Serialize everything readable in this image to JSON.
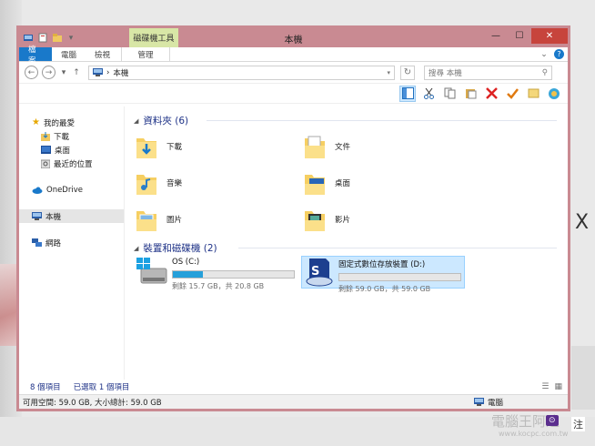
{
  "window": {
    "title": "本機",
    "context_tab": "磁碟機工具",
    "minimize": "—",
    "maximize": "☐",
    "close": "✕"
  },
  "ribbon": {
    "tabs": [
      "檔案",
      "電腦",
      "檢視",
      "管理"
    ],
    "help": "?"
  },
  "address": {
    "back": "←",
    "forward": "→",
    "up": "↑",
    "path_sep": "›",
    "path": "本機",
    "refresh": "↻",
    "search_placeholder": "搜尋 本機",
    "search_icon": "⚲"
  },
  "toolbar_icons": [
    "layout-icon",
    "cut-icon",
    "copy-icon",
    "paste-icon",
    "delete-icon",
    "check-icon",
    "undo-icon",
    "shell-icon"
  ],
  "nav": {
    "favorites": "我的最愛",
    "downloads": "下載",
    "desktop": "桌面",
    "recent": "最近的位置",
    "onedrive": "OneDrive",
    "this_pc": "本機",
    "network": "網路"
  },
  "folders_section": {
    "title": "資料夾 (6)",
    "items": [
      "下載",
      "文件",
      "音樂",
      "桌面",
      "圖片",
      "影片"
    ]
  },
  "drives_section": {
    "title": "裝置和磁碟機 (2)",
    "drives": [
      {
        "name": "OS (C:)",
        "free": "剩餘 15.7 GB，共 20.8 GB",
        "used_fraction": 0.25
      },
      {
        "name": "固定式數位存放裝置 (D:)",
        "free": "剩餘 59.0 GB，共 59.0 GB",
        "used_fraction": 0.0
      }
    ]
  },
  "status": {
    "items": "8 個項目",
    "selected": "已選取 1 個項目",
    "space": "可用空間: 59.0 GB, 大小總計: 59.0 GB",
    "computer": "電腦"
  },
  "background": {
    "right_letter": "X",
    "watermark": "電腦王阿達",
    "watermark_url": "www.kocpc.com.tw",
    "note": "注"
  },
  "colors": {
    "title_bar": "#c98a92",
    "accent": "#1979ca",
    "context_tab": "#d8e6a6",
    "selection": "#cce8ff",
    "section_title": "#1e3287"
  }
}
